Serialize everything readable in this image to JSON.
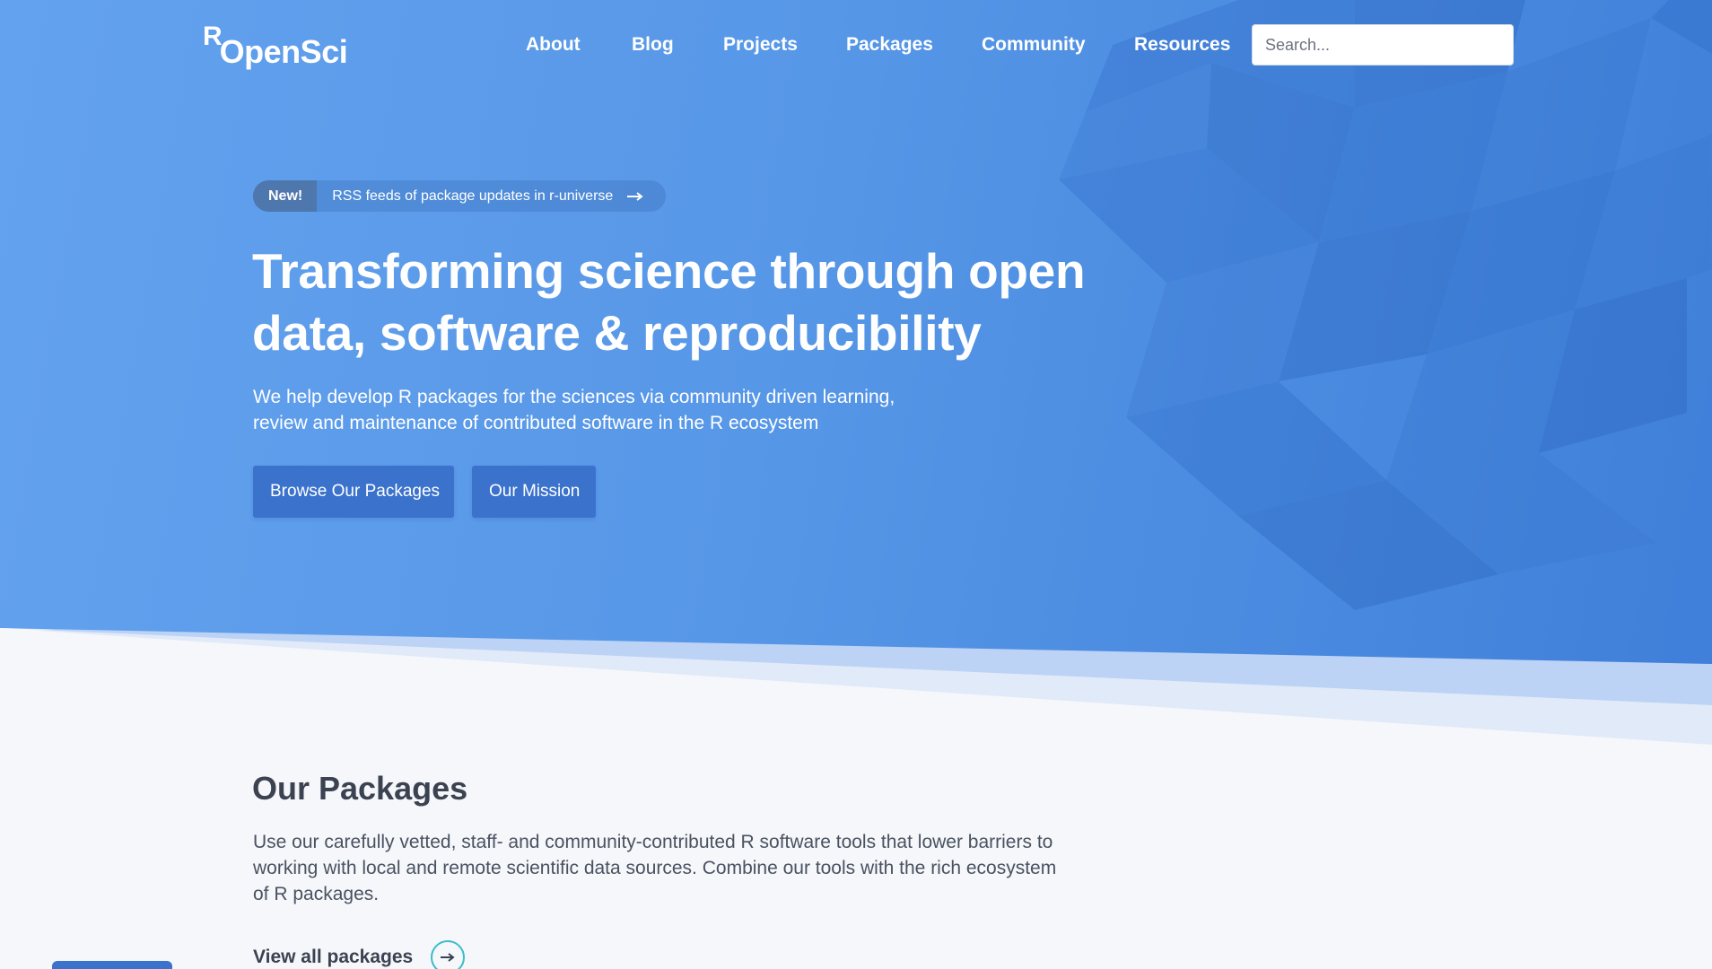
{
  "logo": {
    "r": "R",
    "rest": "OpenSci"
  },
  "nav": {
    "items": [
      "About",
      "Blog",
      "Projects",
      "Packages",
      "Community",
      "Resources"
    ]
  },
  "search": {
    "placeholder": "Search...",
    "value": ""
  },
  "announcement": {
    "badge": "New!",
    "text": "RSS feeds of package updates in r-universe",
    "icon": "arrow-right-icon"
  },
  "hero": {
    "title": "Transforming science through open data, software & reproducibility",
    "subtitle": "We help develop R packages for the sciences via community driven learning, review and maintenance of contributed software in the R ecosystem",
    "buttons": {
      "browse": "Browse Our Packages",
      "mission": "Our Mission"
    }
  },
  "packages": {
    "title": "Our Packages",
    "text": "Use our carefully vetted, staff- and community-contributed R software tools that lower barriers to working with local and remote scientific data sources. Combine our tools with the rich ecosystem of R packages.",
    "link": "View all packages",
    "link_icon": "arrow-right-circle-icon"
  },
  "colors": {
    "hero_start": "#63a2ee",
    "hero_end": "#3f7fd9",
    "button": "#3a72cc",
    "accent_circle": "#3bbdc7",
    "page_bg": "#f5f7fb"
  }
}
